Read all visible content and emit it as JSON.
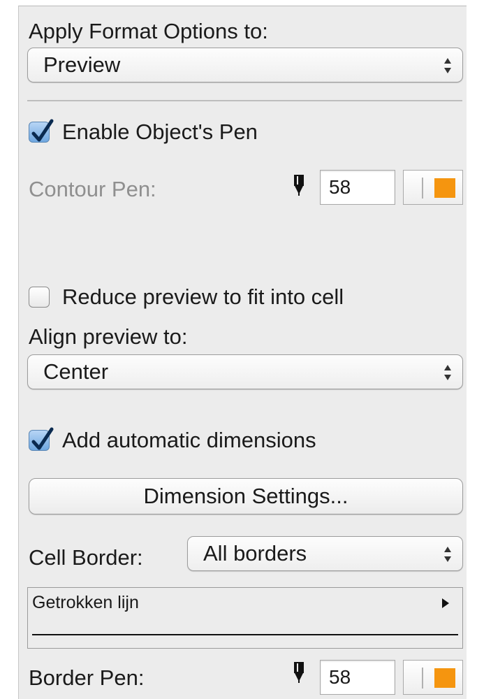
{
  "format": {
    "apply_label": "Apply Format Options to:",
    "apply_value": "Preview"
  },
  "pen": {
    "enable_label": "Enable Object's Pen",
    "enable_checked": true,
    "contour_label": "Contour Pen:",
    "contour_value": "58",
    "contour_color": "#f5950f"
  },
  "preview": {
    "reduce_label": "Reduce preview to fit into cell",
    "reduce_checked": false,
    "align_label": "Align preview to:",
    "align_value": "Center"
  },
  "dimensions": {
    "auto_label": "Add automatic dimensions",
    "auto_checked": true,
    "settings_button": "Dimension Settings..."
  },
  "border": {
    "cell_border_label": "Cell Border:",
    "cell_border_value": "All borders",
    "line_type": "Getrokken lijn",
    "border_pen_label": "Border Pen:",
    "border_pen_value": "58",
    "border_pen_color": "#f5950f"
  },
  "icons": {
    "pen": "pen-nib-icon",
    "stepper": "up-down-arrows-icon",
    "checkmark": "checkmark-icon",
    "disclosure": "triangle-right-icon"
  }
}
